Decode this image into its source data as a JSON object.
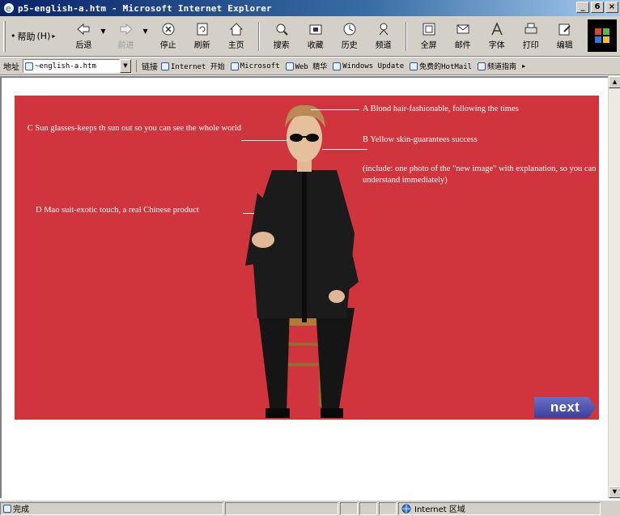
{
  "window": {
    "title": "p5-english-a.htm - Microsoft Internet Explorer",
    "controls": [
      "_",
      "6",
      "×"
    ]
  },
  "toolbar": {
    "help_label": "帮助",
    "buttons": [
      {
        "label": "后退",
        "icon": "back-arrow-icon"
      },
      {
        "label": "前进",
        "icon": "forward-arrow-icon"
      },
      {
        "label": "停止",
        "icon": "stop-icon"
      },
      {
        "label": "刷新",
        "icon": "refresh-icon"
      },
      {
        "label": "主页",
        "icon": "home-icon"
      },
      {
        "label": "搜索",
        "icon": "search-icon"
      },
      {
        "label": "收藏",
        "icon": "favorites-icon"
      },
      {
        "label": "历史",
        "icon": "history-icon"
      },
      {
        "label": "频道",
        "icon": "channels-icon"
      },
      {
        "label": "全屏",
        "icon": "fullscreen-icon"
      },
      {
        "label": "邮件",
        "icon": "mail-icon"
      },
      {
        "label": "字体",
        "icon": "font-icon"
      },
      {
        "label": "打印",
        "icon": "print-icon"
      },
      {
        "label": "编辑",
        "icon": "edit-icon"
      }
    ]
  },
  "addressbar": {
    "label": "地址",
    "value": "~english-a.htm",
    "links_label": "链接",
    "links": [
      "Internet 开始",
      "Microsoft",
      "Web 精华",
      "Windows Update",
      "免费的HotMail",
      "频道指南"
    ]
  },
  "page": {
    "annotations": {
      "a": "A Blond hair-fashionable, following the times",
      "b": "B Yellow skin-guarantees success",
      "note": "(include: one photo of the \"new image\" with explanation, so you can understand immediately)",
      "c": "C Sun glasses-keeps th sun out so you can see the whole world",
      "d": "D Mao suit-exotic touch, a real  Chinese product"
    },
    "next_label": "next"
  },
  "statusbar": {
    "status_text": "完成",
    "zone_text": "Internet 区域"
  },
  "colors": {
    "stage_bg": "#d0343c",
    "next_button": "#3a3f9a"
  }
}
